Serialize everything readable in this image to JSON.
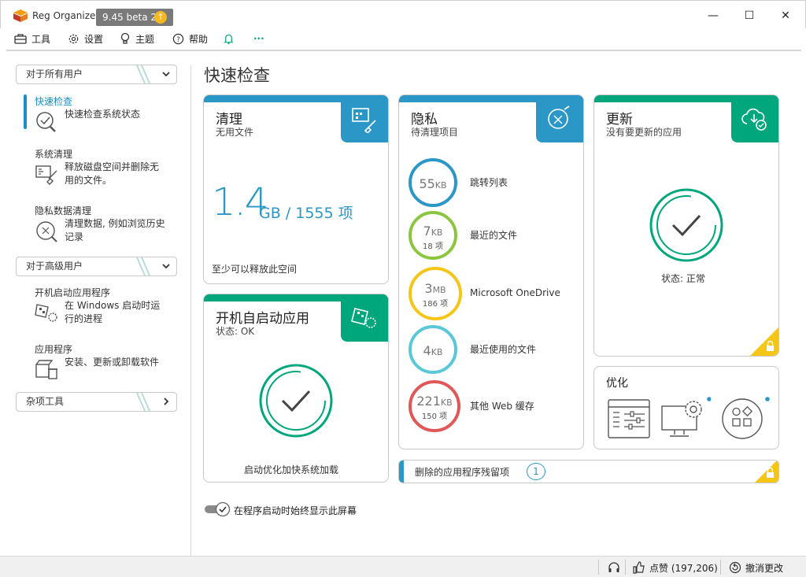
{
  "window": {
    "app_name": "Reg Organizer",
    "version": "9.45 beta 2",
    "update_glyph": "↑",
    "controls": {
      "minimize": "—",
      "maximize": "☐",
      "close": "✕"
    }
  },
  "toolbar": {
    "tools": "工具",
    "settings": "设置",
    "theme": "主题",
    "help": "帮助",
    "more": "···"
  },
  "sidebar": {
    "section_all_users": "对于所有用户",
    "section_advanced": "对于高级用户",
    "section_misc": "杂项工具",
    "items": [
      {
        "title": "快速检查",
        "desc": "快速检查系统状态",
        "icon": "quick-check-icon",
        "active": true
      },
      {
        "title": "系统清理",
        "desc": "释放磁盘空间并删除无用的文件。",
        "icon": "system-cleanup-icon"
      },
      {
        "title": "隐私数据清理",
        "desc": "清理数据, 例如浏览历史记录",
        "icon": "privacy-cleanup-icon"
      },
      {
        "title": "开机启动应用程序",
        "desc": "在 Windows 启动时运行的进程",
        "icon": "startup-apps-icon"
      },
      {
        "title": "应用程序",
        "desc": "安装、更新或卸载软件",
        "icon": "applications-icon"
      }
    ]
  },
  "main": {
    "page_title": "快速检查",
    "clean_card": {
      "title": "清理",
      "subtitle": "无用文件",
      "size_value": "1.4",
      "size_rest": "GB / 1555 项",
      "footer": "至少可以释放此空间"
    },
    "startup_card": {
      "title": "开机自启动应用",
      "subtitle": "状态: OK",
      "footer": "启动优化加快系统加载"
    },
    "privacy_card": {
      "title": "隐私",
      "subtitle": "待清理项目",
      "items": [
        {
          "value": "55",
          "unit": "KB",
          "count": "",
          "label": "跳转列表",
          "color": "#2a97c7"
        },
        {
          "value": "7",
          "unit": "KB",
          "count": "18 项",
          "label": "最近的文件",
          "color": "#8cc63f"
        },
        {
          "value": "3",
          "unit": "MB",
          "count": "186 项",
          "label": "Microsoft OneDrive",
          "color": "#f5c518"
        },
        {
          "value": "4",
          "unit": "KB",
          "count": "",
          "label": "最近使用的文件",
          "color": "#5bc8d8"
        },
        {
          "value": "221",
          "unit": "KB",
          "count": "150 项",
          "label": "其他 Web 缓存",
          "color": "#e05858"
        }
      ]
    },
    "update_card": {
      "title": "更新",
      "subtitle": "没有要更新的应用",
      "status": "状态: 正常"
    },
    "optimize_card": {
      "title": "优化"
    },
    "residue": {
      "label": "删除的应用程序残留项",
      "count": "1"
    },
    "show_on_start": "在程序启动时始终显示此屏幕"
  },
  "statusbar": {
    "like": "点赞 (197,206)",
    "undo": "撤消更改"
  },
  "colors": {
    "blue": "#2a97c7",
    "teal": "#00a67c",
    "lock_yellow": "#f5c518"
  }
}
